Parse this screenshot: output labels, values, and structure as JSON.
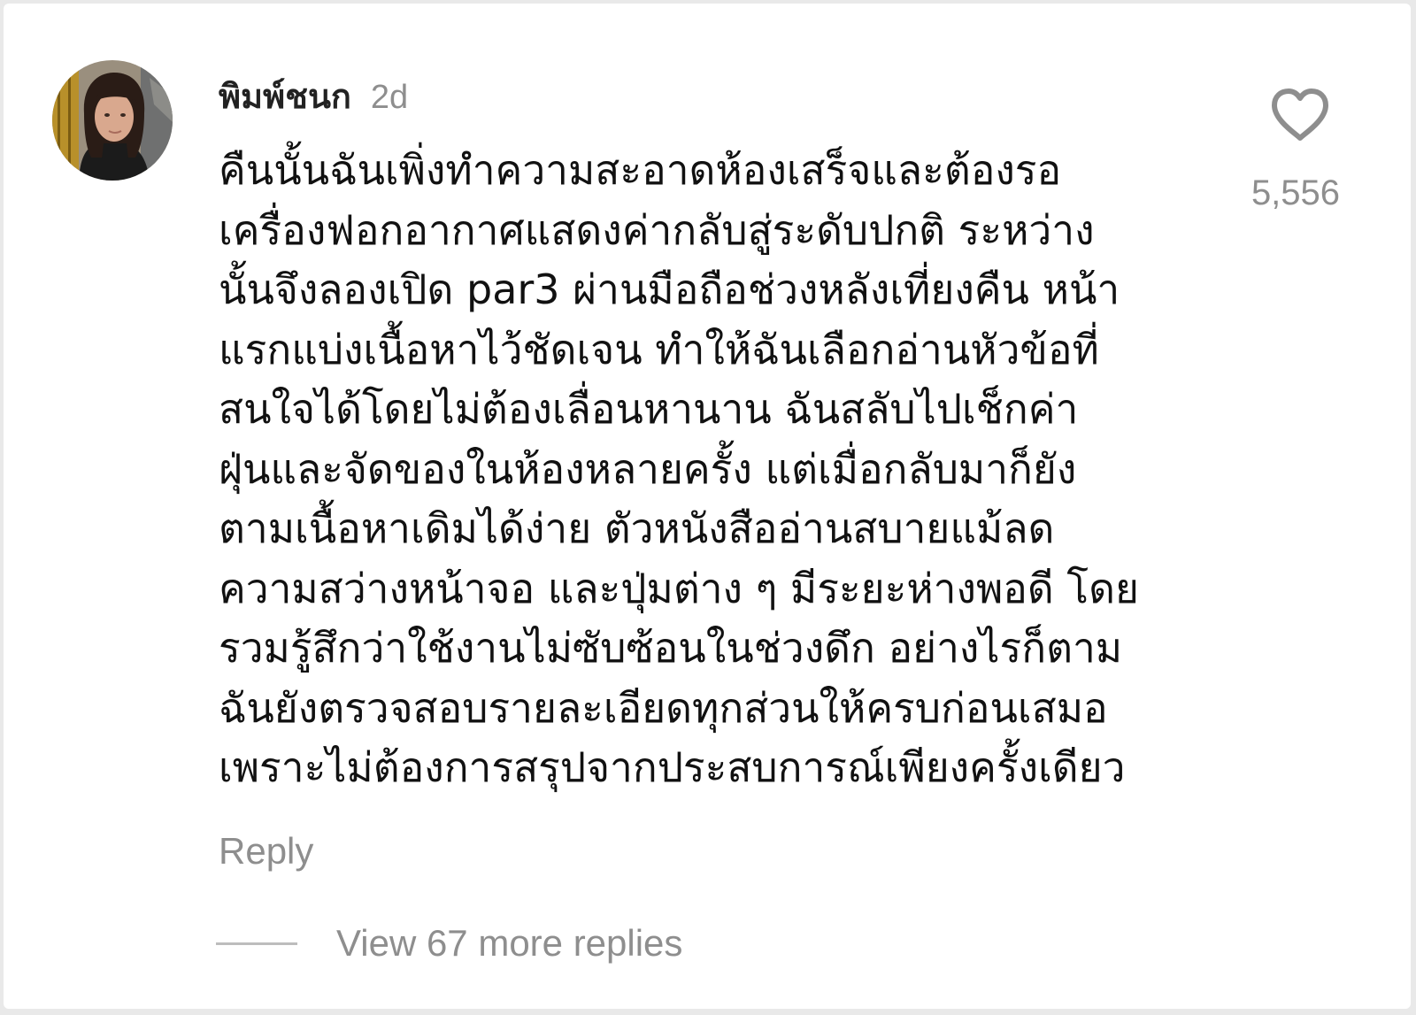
{
  "comment": {
    "username": "พิมพ์ชนก",
    "timestamp": "2d",
    "lines": [
      "คืนนั้นฉันเพิ่งทำความสะอาดห้องเสร็จและต้องรอ",
      "เครื่องฟอกอากาศแสดงค่ากลับสู่ระดับปกติ ระหว่าง",
      "นั้นจึงลองเปิด par3 ผ่านมือถือช่วงหลังเที่ยงคืน หน้า",
      "แรกแบ่งเนื้อหาไว้ชัดเจน ทำให้ฉันเลือกอ่านหัวข้อที่",
      "สนใจได้โดยไม่ต้องเลื่อนหานาน ฉันสลับไปเช็กค่า",
      "ฝุ่นและจัดของในห้องหลายครั้ง แต่เมื่อกลับมาก็ยัง",
      "ตามเนื้อหาเดิมได้ง่าย ตัวหนังสืออ่านสบายแม้ลด",
      "ความสว่างหน้าจอ และปุ่มต่าง ๆ มีระยะห่างพอดี โดย",
      "รวมรู้สึกว่าใช้งานไม่ซับซ้อนในช่วงดึก อย่างไรก็ตาม",
      "ฉันยังตรวจสอบรายละเอียดทุกส่วนให้ครบก่อนเสมอ",
      "เพราะไม่ต้องการสรุปจากประสบการณ์เพียงครั้งเดียว"
    ],
    "like_count": "5,556",
    "reply_label": "Reply",
    "view_replies_label": "View 67 more replies"
  },
  "icons": {
    "like": "heart-outline-icon",
    "avatar": "user-avatar-photo"
  },
  "colors": {
    "background": "#ffffff",
    "text_primary": "#111111",
    "text_secondary": "#8e8e8e",
    "icon": "#8e8e8e"
  }
}
